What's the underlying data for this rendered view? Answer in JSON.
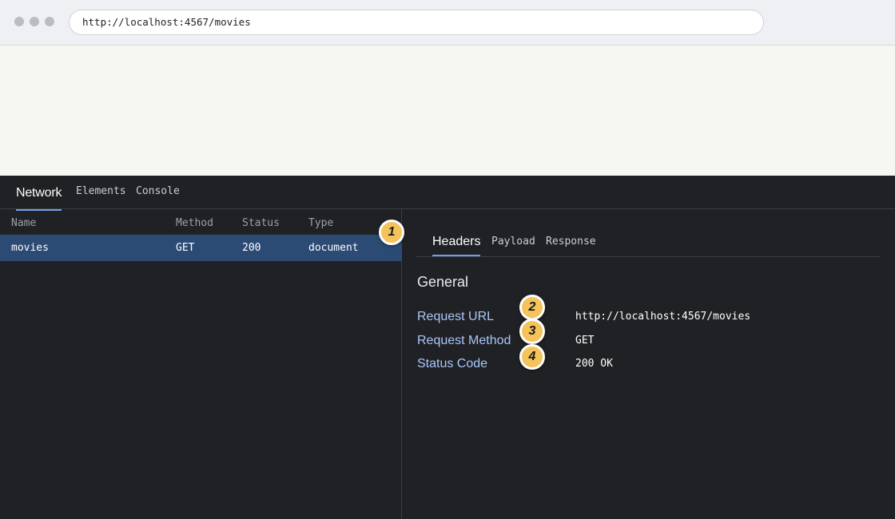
{
  "browser": {
    "url": "http://localhost:4567/movies"
  },
  "devtools": {
    "tabs": [
      "Network",
      "Elements",
      "Console"
    ],
    "active_tab": "Network",
    "columns": [
      "Name",
      "Method",
      "Status",
      "Type"
    ],
    "requests": [
      {
        "name": "movies",
        "method": "GET",
        "status": "200",
        "type": "document"
      }
    ],
    "detail_tabs": [
      "Headers",
      "Payload",
      "Response"
    ],
    "active_detail_tab": "Headers",
    "section_title": "General",
    "headers": [
      {
        "key": "Request URL",
        "value": "http://localhost:4567/movies"
      },
      {
        "key": "Request Method",
        "value": "GET"
      },
      {
        "key": "Status Code",
        "value": "200 OK"
      }
    ]
  },
  "annotations": [
    "1",
    "2",
    "3",
    "4"
  ],
  "colors": {
    "selected_row": "#2b4a74",
    "header_key": "#a8c7fa",
    "badge": "#f5c35c",
    "tab_underline": "#6ea0e6"
  }
}
